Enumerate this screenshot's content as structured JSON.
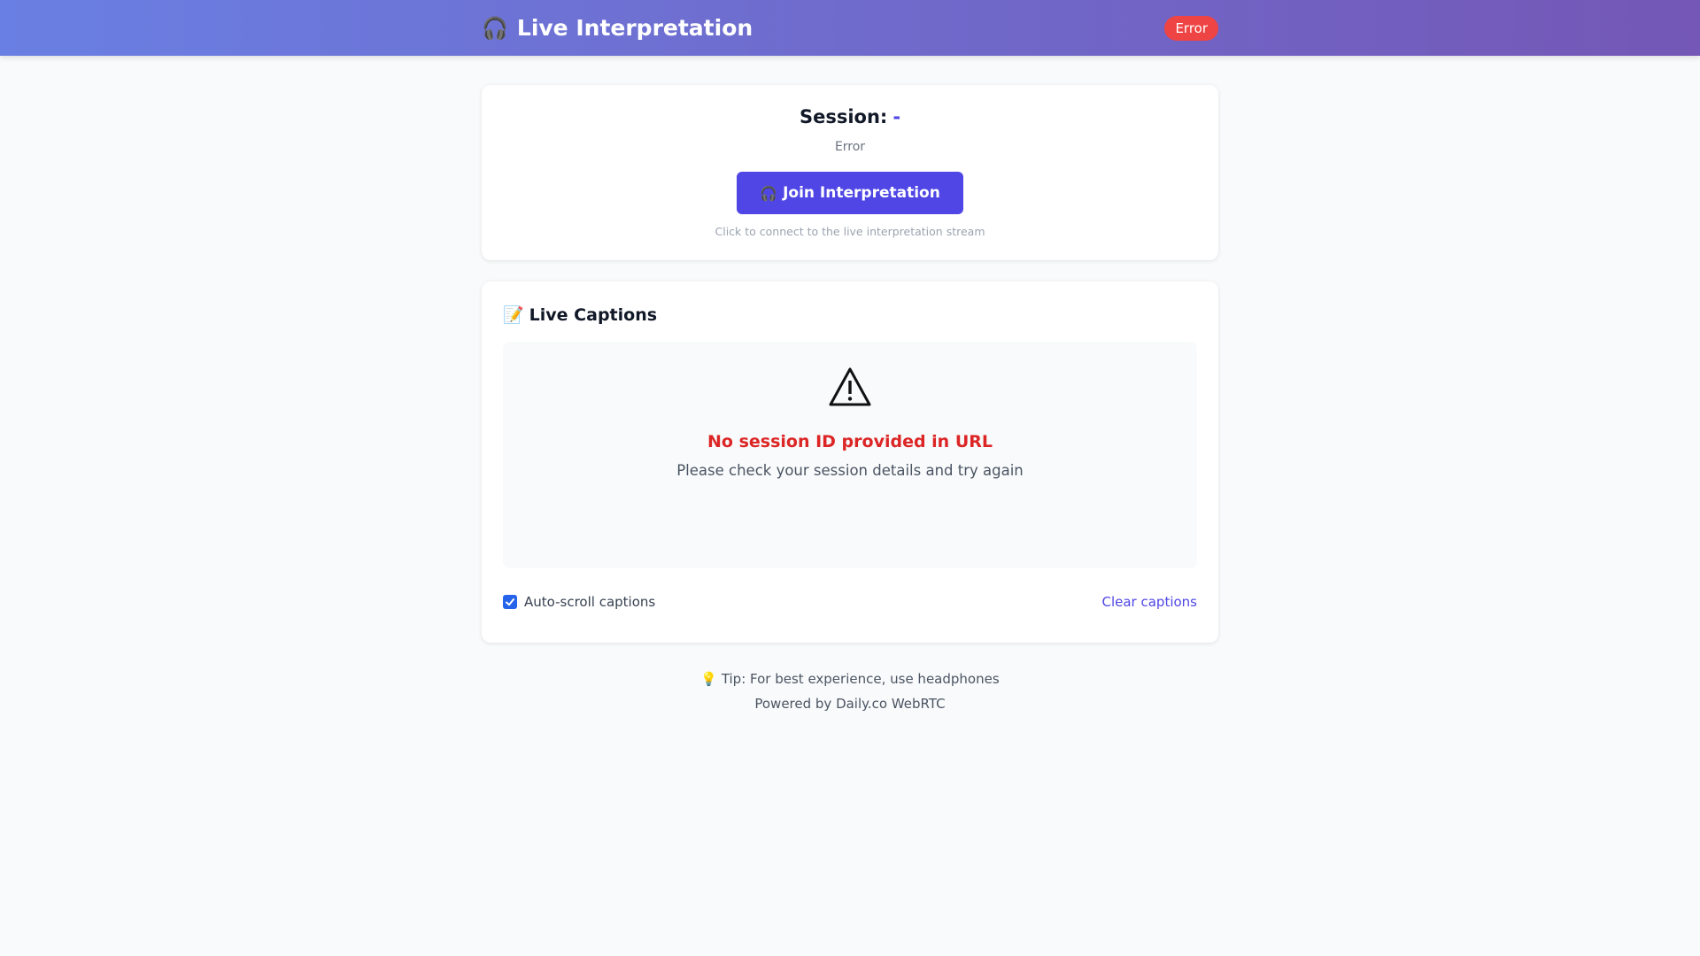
{
  "header": {
    "title": "Live Interpretation",
    "title_icon": "headphones-icon",
    "status_badge": "Error"
  },
  "session": {
    "label": "Session:",
    "id": "-",
    "status": "Error",
    "join_button_label": "Join Interpretation",
    "join_button_icon": "headphones-icon",
    "hint": "Click to connect to the live interpretation stream"
  },
  "captions": {
    "heading": "Live Captions",
    "heading_icon": "memo-icon",
    "error_icon": "warning-icon",
    "error_message": "No session ID provided in URL",
    "error_detail": "Please check your session details and try again",
    "autoscroll_label": "Auto-scroll captions",
    "autoscroll_checked": true,
    "clear_label": "Clear captions"
  },
  "footer": {
    "tip": "Tip: For best experience, use headphones",
    "tip_icon": "lightbulb-icon",
    "powered_by": "Powered by Daily.co WebRTC"
  },
  "colors": {
    "header_gradient_start": "#6a7fe3",
    "header_gradient_end": "#7457b6",
    "accent": "#4f46e5",
    "error": "#dc2626",
    "badge_error": "#ef4444"
  }
}
